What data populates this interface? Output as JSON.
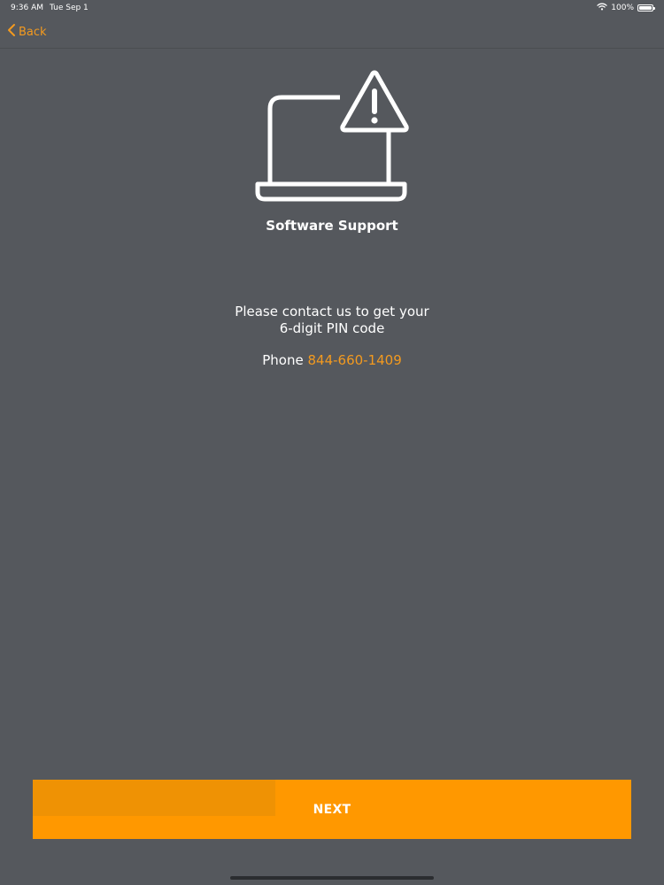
{
  "status_bar": {
    "time": "9:36 AM",
    "date": "Tue Sep 1",
    "battery_label": "100%",
    "battery_level": 1.0,
    "icons": [
      "wifi-icon",
      "battery-icon"
    ]
  },
  "nav": {
    "back_label": "Back",
    "back_icon": "chevron-left-icon"
  },
  "content": {
    "icon": "laptop-warning-icon",
    "title": "Software Support",
    "message_line1": "Please contact us to get your",
    "message_line2": "6-digit PIN code",
    "phone_label": "Phone",
    "phone_number": "844-660-1409"
  },
  "footer": {
    "next_label": "NEXT",
    "next_progress": 0.405
  },
  "colors": {
    "background": "#55585d",
    "accent": "#f39a1f",
    "button": "#ff9800",
    "button_progress": "#ef9204",
    "text": "#ffffff"
  }
}
